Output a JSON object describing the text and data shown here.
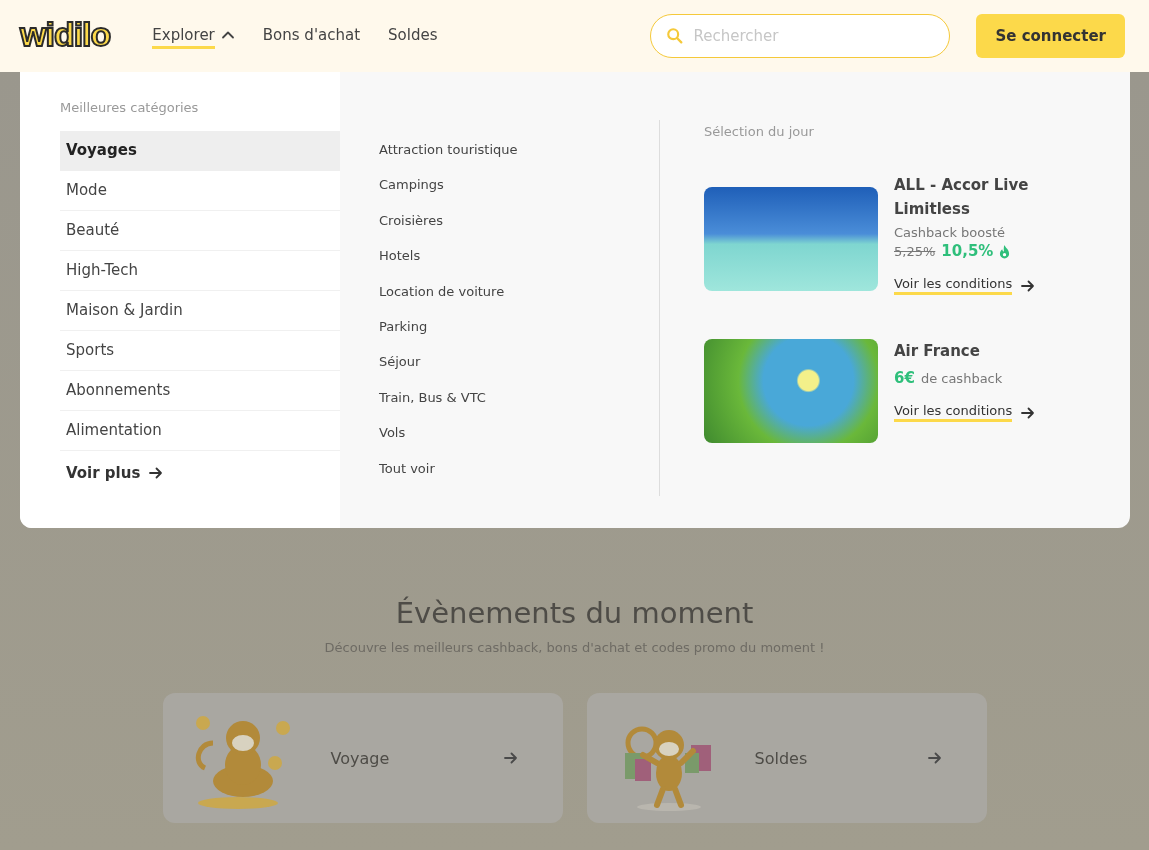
{
  "header": {
    "logo": "widilo",
    "nav": [
      {
        "label": "Explorer",
        "selected": true,
        "expanded": true
      },
      {
        "label": "Bons d'achat",
        "selected": false
      },
      {
        "label": "Soldes",
        "selected": false
      }
    ],
    "search": {
      "placeholder": "Rechercher"
    },
    "login_button": "Se connecter"
  },
  "menu": {
    "categories_title": "Meilleures catégories",
    "categories": [
      {
        "label": "Voyages",
        "selected": true
      },
      {
        "label": "Mode",
        "selected": false
      },
      {
        "label": "Beauté",
        "selected": false
      },
      {
        "label": "High-Tech",
        "selected": false
      },
      {
        "label": "Maison & Jardin",
        "selected": false
      },
      {
        "label": "Sports",
        "selected": false
      },
      {
        "label": "Abonnements",
        "selected": false
      },
      {
        "label": "Alimentation",
        "selected": false
      }
    ],
    "more_link": "Voir plus",
    "subcategories": [
      "Attraction touristique",
      "Campings",
      "Croisières",
      "Hotels",
      "Location de voiture",
      "Parking",
      "Séjour",
      "Train, Bus & VTC",
      "Vols",
      "Tout voir"
    ],
    "daily": {
      "title": "Sélection du jour",
      "offers": [
        {
          "kind": "boosted",
          "title": "ALL - Accor Live Limitless",
          "label": "Cashback boosté",
          "old_rate": "5,25%",
          "rate": "10,5%",
          "link": "Voir les conditions"
        },
        {
          "kind": "fixed",
          "title": "Air France",
          "amount": "6€",
          "suffix": "de cashback",
          "link": "Voir les conditions"
        }
      ]
    }
  },
  "events": {
    "title": "Évènements du moment",
    "subtitle": "Découvre les meilleurs cashback, bons d'achat et codes promo du moment !",
    "cards": [
      {
        "label": "Voyage"
      },
      {
        "label": "Soldes"
      }
    ]
  }
}
